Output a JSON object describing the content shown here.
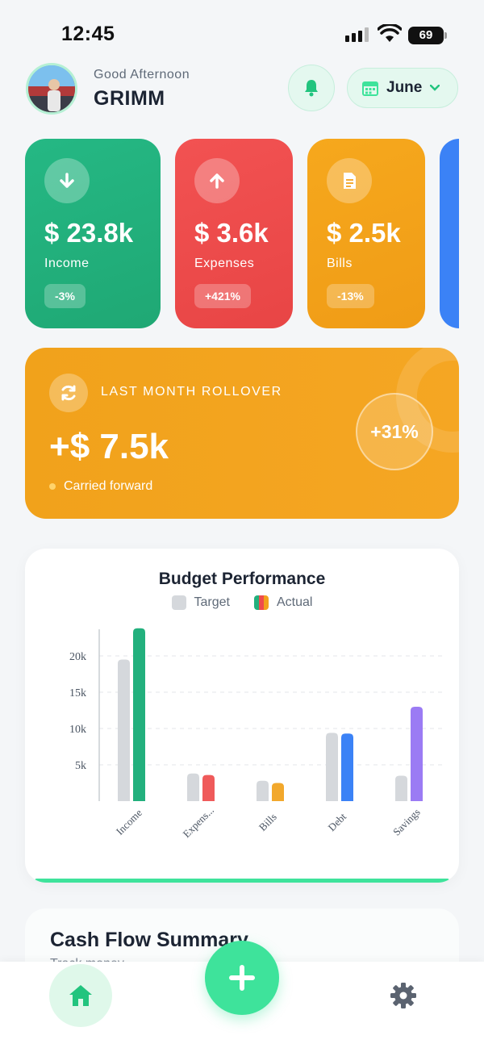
{
  "status_bar": {
    "time": "12:45",
    "battery": "69"
  },
  "header": {
    "greeting": "Good Afternoon",
    "user_name": "GRIMM",
    "month": "June"
  },
  "cards": [
    {
      "amount": "$ 23.8k",
      "label": "Income",
      "badge": "-3%",
      "color": "#22b27d",
      "icon": "arrow-down-icon"
    },
    {
      "amount": "$ 3.6k",
      "label": "Expenses",
      "badge": "+421%",
      "color": "#ee4b4b",
      "icon": "arrow-up-icon"
    },
    {
      "amount": "$ 2.5k",
      "label": "Bills",
      "badge": "-13%",
      "color": "#f3a11b",
      "icon": "document-icon"
    }
  ],
  "rollover": {
    "title": "LAST MONTH ROLLOVER",
    "amount": "+$ 7.5k",
    "note": "Carried forward",
    "percent": "+31%"
  },
  "chart_data": {
    "type": "bar",
    "title": "Budget Performance",
    "categories": [
      "Income",
      "Expens...",
      "Bills",
      "Debt",
      "Savings"
    ],
    "series": [
      {
        "name": "Target",
        "values": [
          19500,
          3800,
          2800,
          9400,
          3500
        ],
        "color": "#d5d8dc"
      },
      {
        "name": "Actual",
        "values": [
          23800,
          3600,
          2500,
          9300,
          13000
        ],
        "colors": [
          "#22b07d",
          "#ef5a5a",
          "#f2a82c",
          "#3b82f6",
          "#9b7bf4"
        ]
      }
    ],
    "ylim": [
      0,
      24000
    ],
    "yticks": [
      5000,
      10000,
      15000,
      20000
    ],
    "ytick_labels": [
      "5k",
      "10k",
      "15k",
      "20k"
    ],
    "grid": true,
    "legend": "top-center"
  },
  "cashflow": {
    "title": "Cash Flow Summary",
    "subtitle": "Track money"
  },
  "nav": {
    "home": "home-icon",
    "add": "plus-icon",
    "settings": "gear-icon"
  },
  "colors": {
    "accent": "#3ee39b",
    "rollover": "#f3a31e"
  }
}
